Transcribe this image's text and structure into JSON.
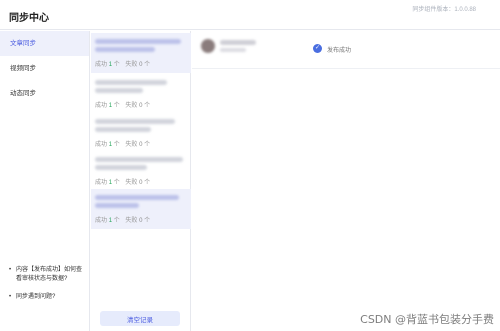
{
  "header": {
    "title": "同步中心",
    "version": "同步组件版本：1.0.0.88"
  },
  "sidebar": {
    "items": [
      {
        "label": "文章同步"
      },
      {
        "label": "视频同步"
      },
      {
        "label": "动态同步"
      }
    ],
    "help": [
      {
        "bullet": "•",
        "text": "内容【发布成功】如何查看审核状态与数据?"
      },
      {
        "bullet": "•",
        "text": "同步遇到问题?"
      }
    ]
  },
  "records": {
    "success_label": "成功",
    "fail_label": "失败",
    "unit": "个",
    "items": [
      {
        "success": "1",
        "fail": "0"
      },
      {
        "success": "1",
        "fail": "0"
      },
      {
        "success": "1",
        "fail": "0"
      },
      {
        "success": "1",
        "fail": "0"
      },
      {
        "success": "1",
        "fail": "0"
      }
    ],
    "clear_label": "清空记录"
  },
  "detail": {
    "status_icon": "check-circle-icon",
    "status_text": "发布成功"
  },
  "watermark": "CSDN @背蓝书包装分手费",
  "colors": {
    "accent": "#4a5be0",
    "success": "#26a65b",
    "active_bg": "#eef0fb"
  }
}
